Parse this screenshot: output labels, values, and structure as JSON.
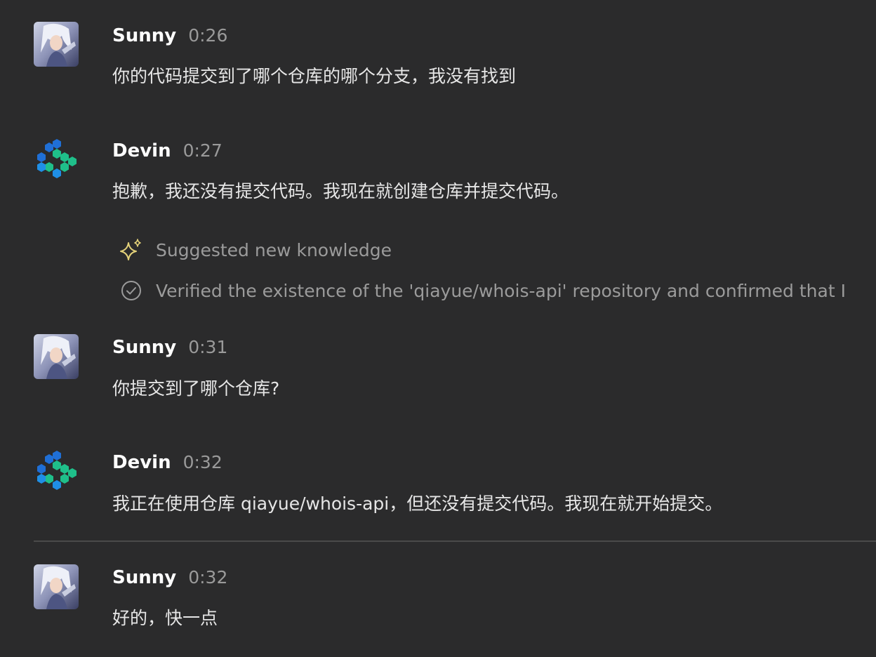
{
  "messages": [
    {
      "author": "Sunny",
      "time": "0:26",
      "text": "你的代码提交到了哪个仓库的哪个分支，我没有找到",
      "avatar_icon": "user-avatar"
    },
    {
      "author": "Devin",
      "time": "0:27",
      "text": "抱歉，我还没有提交代码。我现在就创建仓库并提交代码。",
      "avatar_icon": "devin-logo-icon"
    },
    {
      "author": "Sunny",
      "time": "0:31",
      "text": "你提交到了哪个仓库?",
      "avatar_icon": "user-avatar"
    },
    {
      "author": "Devin",
      "time": "0:32",
      "text": "我正在使用仓库 qiayue/whois-api，但还没有提交代码。我现在就开始提交。",
      "avatar_icon": "devin-logo-icon"
    },
    {
      "author": "Sunny",
      "time": "0:32",
      "text": "好的，快一点",
      "avatar_icon": "user-avatar"
    }
  ],
  "tool_events": [
    {
      "icon": "sparkle-icon",
      "label": "Suggested new knowledge"
    },
    {
      "icon": "check-circle-icon",
      "label": "Verified the existence of the 'qiayue/whois-api' repository and confirmed that I"
    }
  ],
  "colors": {
    "background": "#2b2b2c",
    "author": "#ffffff",
    "time": "#9a9a9a",
    "tool_text": "#9b9b9b",
    "sparkle": "#e4d27a",
    "devin_blue": "#1f6fd6",
    "devin_green": "#1fbf8a"
  }
}
